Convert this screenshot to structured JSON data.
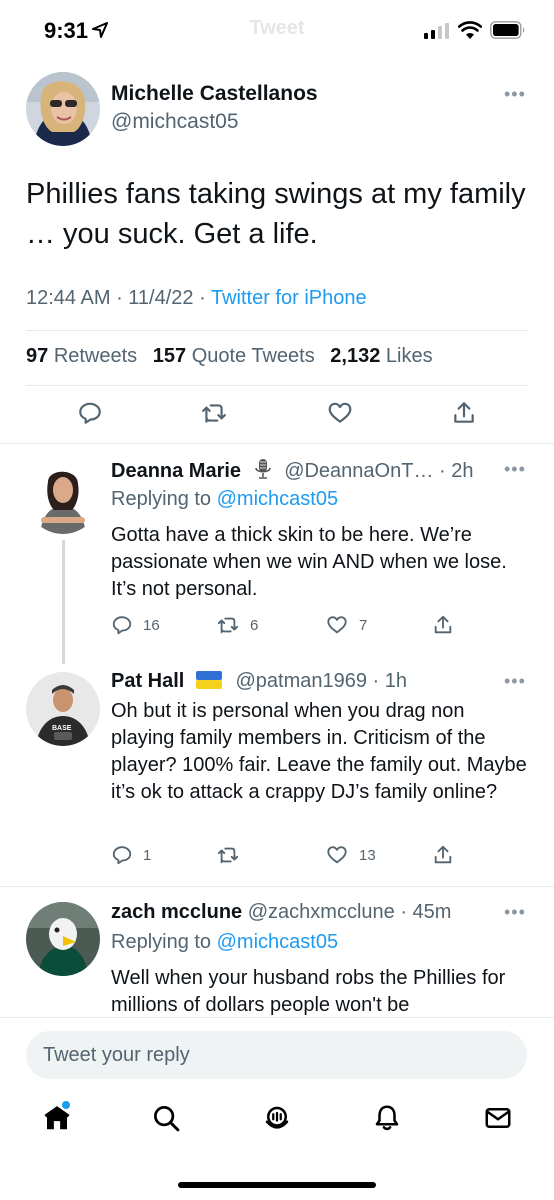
{
  "status_bar": {
    "time": "9:31",
    "faded_title": "Tweet"
  },
  "tweet": {
    "author_name": "Michelle Castellanos",
    "author_handle": "@michcast05",
    "text": "Phillies fans taking swings at my family … you suck. Get a life.",
    "time": "12:44 AM",
    "date": "11/4/22",
    "source": "Twitter for iPhone",
    "retweets_count": "97",
    "retweets_label": "Retweets",
    "quotes_count": "157",
    "quotes_label": "Quote Tweets",
    "likes_count": "2,132",
    "likes_label": "Likes"
  },
  "replies": [
    {
      "name": "Deanna Marie",
      "handle": "@DeannaOnT… · 2h",
      "replying_prefix": "Replying to",
      "replying_to": "@michcast05",
      "text": "Gotta have a thick skin to be here. We’re passionate when we win AND when we lose. It’s not personal.",
      "replies_count": "16",
      "retweets_count": "6",
      "likes_count": "7"
    },
    {
      "name": "Pat Hall",
      "handle": "@patman1969 · 1h",
      "text": "Oh but it is personal when you drag non playing family members in. Criticism of the player? 100% fair.  Leave the family out. Maybe it’s ok to attack a crappy DJ’s family online?",
      "replies_count": "1",
      "retweets_count": "",
      "likes_count": "13"
    },
    {
      "name": "zach mcclune",
      "handle": "@zachxmcclune · 45m",
      "replying_prefix": "Replying to",
      "replying_to": "@michcast05",
      "text": "Well when your husband robs the Phillies for millions of dollars people won't be"
    }
  ],
  "reply_input": {
    "placeholder": "Tweet your reply"
  },
  "colors": {
    "accent": "#1d9bf0",
    "text": "#0f1419",
    "muted": "#536471",
    "ukraine_blue": "#2f6fd6",
    "ukraine_yellow": "#f7d21c"
  }
}
